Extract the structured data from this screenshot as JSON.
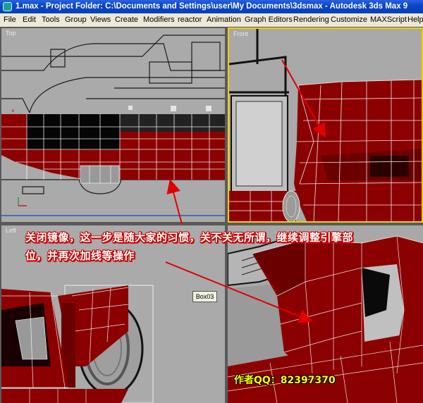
{
  "window": {
    "title": "1.max - Project Folder: C:\\Documents and Settings\\user\\My Documents\\3dsmax - Autodesk 3ds Max 9",
    "app_icon": "3dsmax-app-icon"
  },
  "menu": {
    "items": [
      "File",
      "Edit",
      "Tools",
      "Group",
      "Views",
      "Create",
      "Modifiers",
      "reactor",
      "Animation",
      "Graph Editors",
      "Rendering",
      "Customize",
      "MAXScript",
      "Help"
    ]
  },
  "viewports": {
    "top": {
      "label": "Top"
    },
    "front": {
      "label": "Front"
    },
    "left": {
      "label": "Left"
    },
    "perspective": {
      "label": ""
    }
  },
  "tooltip": {
    "text": "Box03"
  },
  "annotation": {
    "line1": "关闭镜像，这一步是随大家的习惯，关不关无所谓，继续调整引擎部",
    "line2": "位，并再次加线等操作"
  },
  "author": {
    "text": "作者QQ：82397370"
  },
  "colors": {
    "titlebar": "#0a46c8",
    "menubar": "#ece9d8",
    "viewport_bg": "#a9a9a9",
    "model_red": "#8b0000",
    "active_border": "#f0d000",
    "annotation_text": "#ffffff",
    "annotation_outline": "#c80000",
    "arrow": "#e00000",
    "author_text": "#ffff00"
  }
}
